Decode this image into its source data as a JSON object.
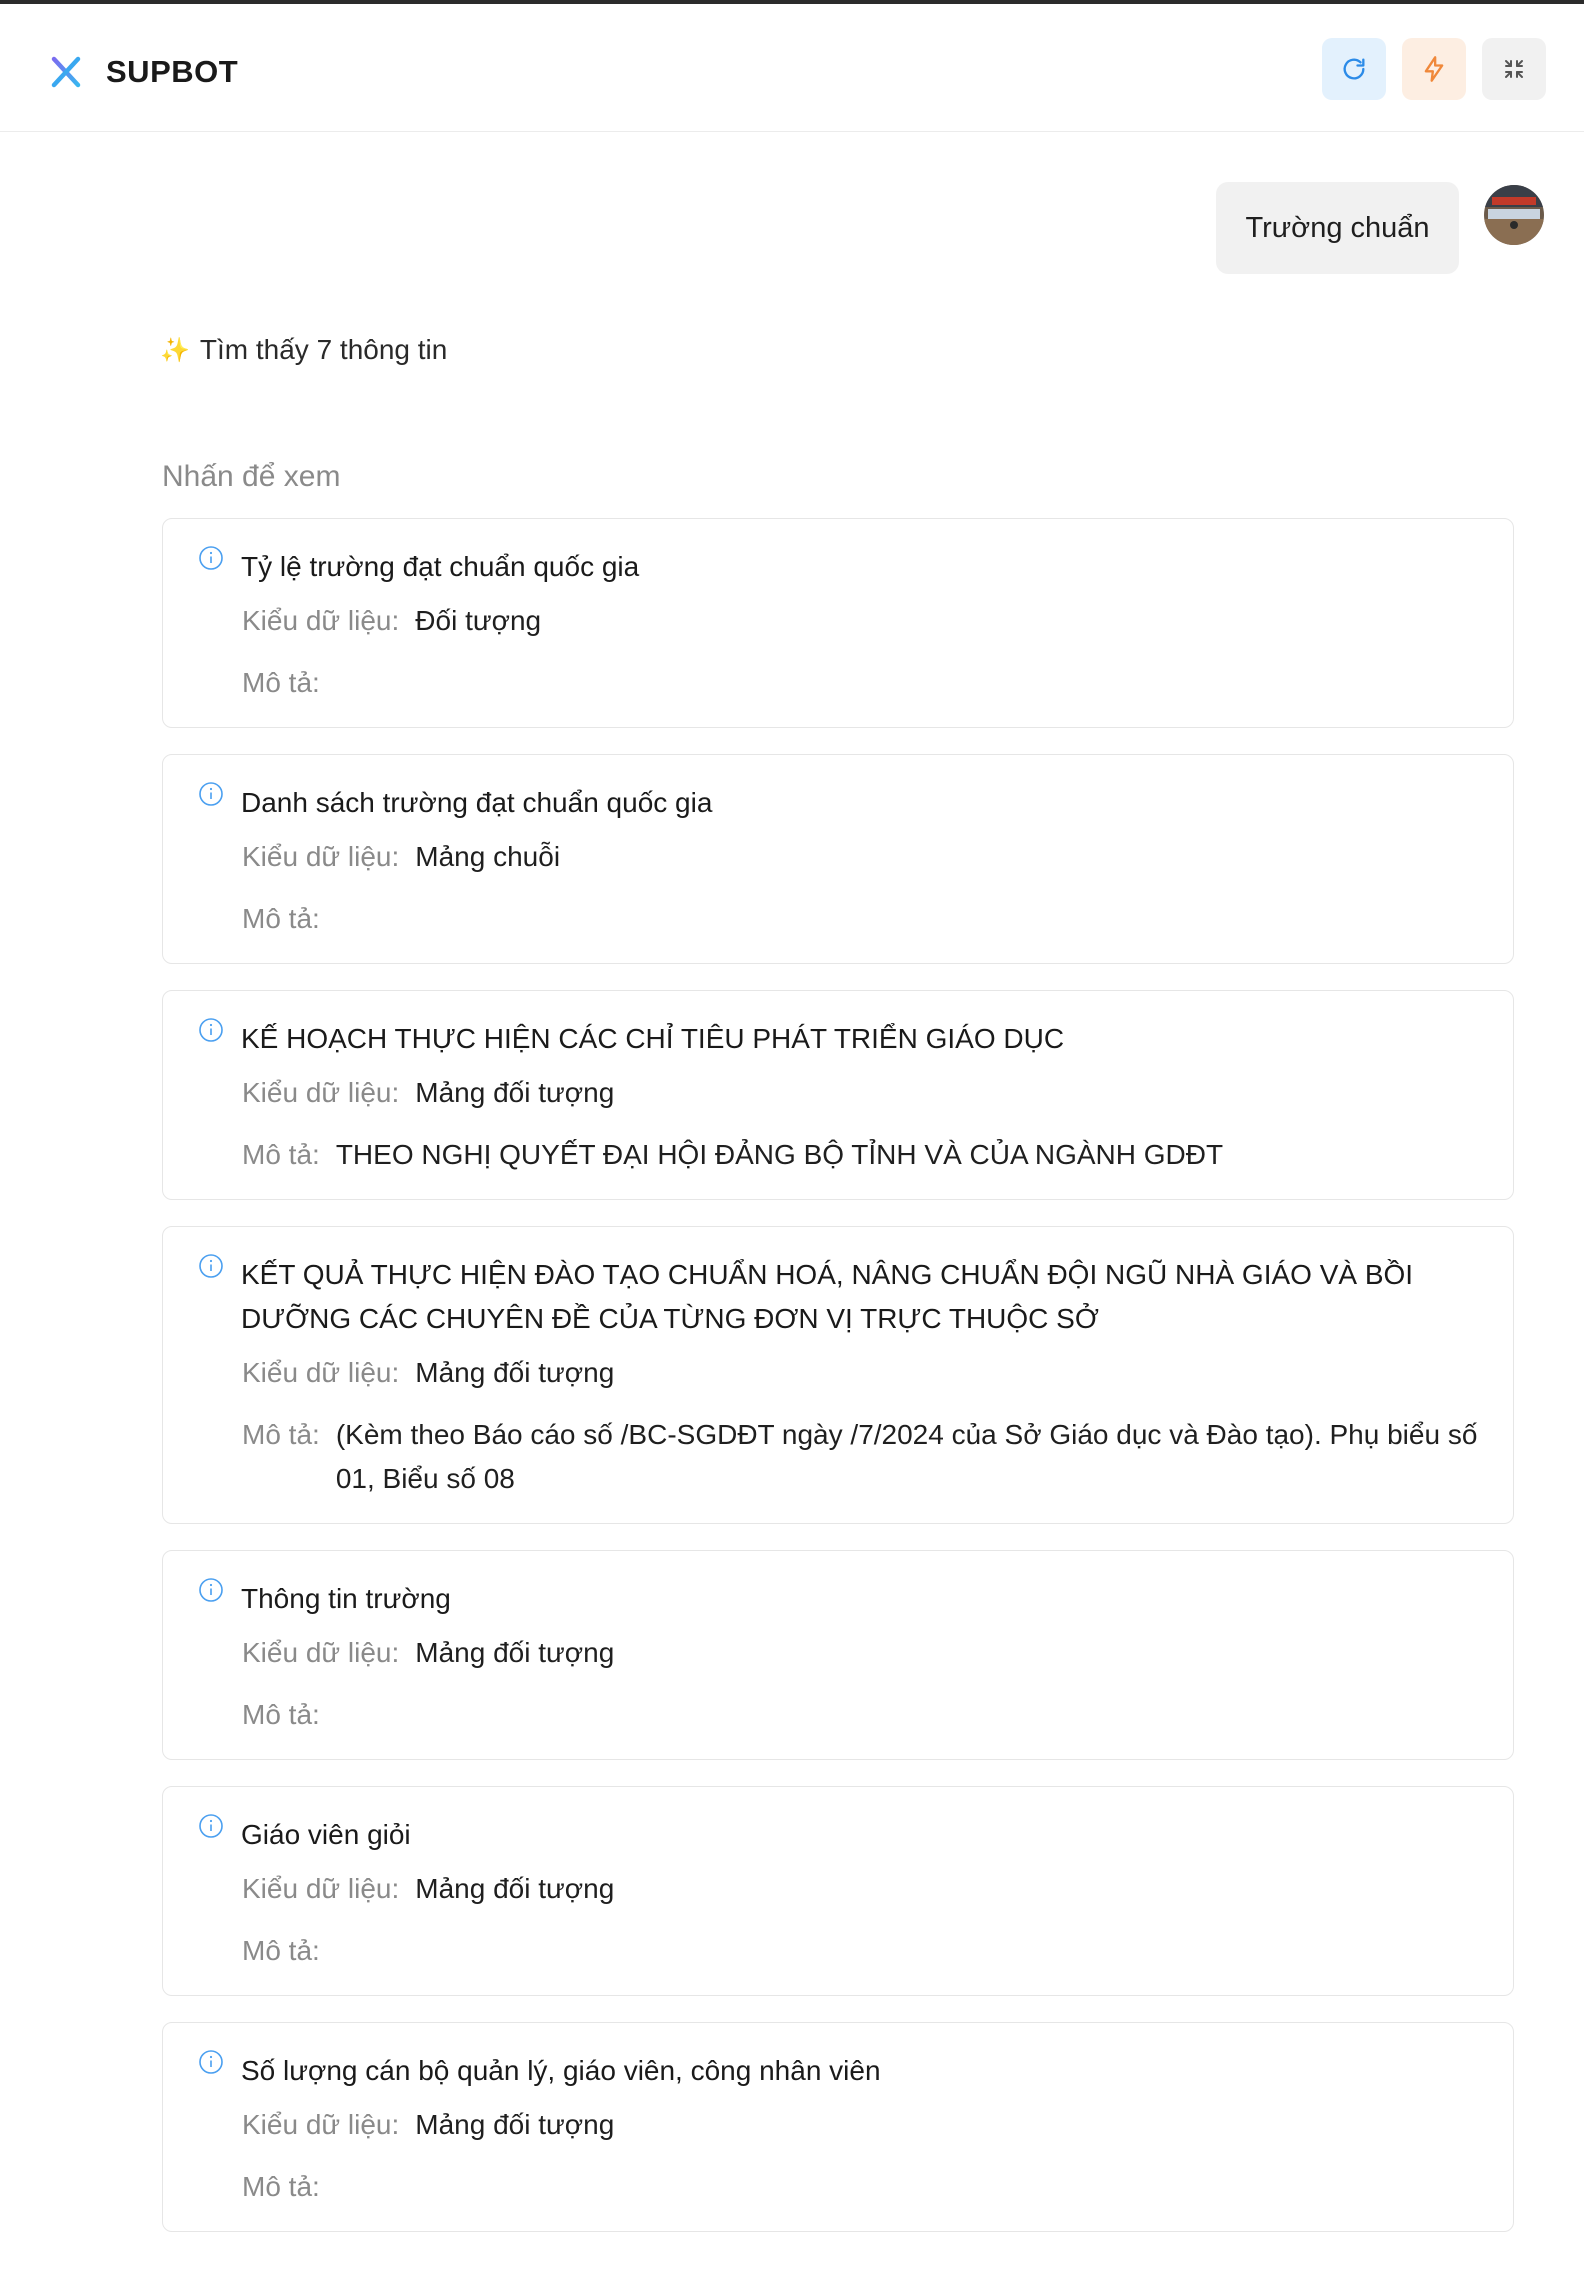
{
  "header": {
    "app_title": "SUPBOT",
    "logo_icon": "x-logo-icon",
    "buttons": {
      "refresh_icon": "refresh-icon",
      "flash_icon": "lightning-icon",
      "collapse_icon": "collapse-icon"
    },
    "colors": {
      "refresh_bg": "#e3f1fd",
      "refresh_fg": "#2b8be8",
      "flash_bg": "#fdeee2",
      "flash_fg": "#f0883a"
    }
  },
  "chat": {
    "user_message": "Trường chuẩn",
    "found_text": "Tìm thấy 7 thông tin",
    "found_icon": "sparkles-icon",
    "hint": "Nhấn để xem"
  },
  "labels": {
    "type_label": "Kiểu dữ liệu:",
    "desc_label": "Mô tả:"
  },
  "results": [
    {
      "title": "Tỷ lệ trường đạt chuẩn quốc gia",
      "type": "Đối tượng",
      "description": ""
    },
    {
      "title": "Danh sách trường đạt chuẩn quốc gia",
      "type": "Mảng chuỗi",
      "description": ""
    },
    {
      "title": "KẾ HOẠCH THỰC HIỆN CÁC CHỈ TIÊU PHÁT TRIỂN GIÁO DỤC",
      "type": "Mảng đối tượng",
      "description": "THEO NGHỊ QUYẾT ĐẠI HỘI ĐẢNG BỘ TỈNH VÀ CỦA NGÀNH GDĐT"
    },
    {
      "title": "KẾT QUẢ THỰC HIỆN ĐÀO TẠO CHUẨN HOÁ, NÂNG CHUẨN ĐỘI NGŨ NHÀ GIÁO VÀ BỒI DƯỠNG CÁC CHUYÊN ĐỀ CỦA TỪNG ĐƠN VỊ TRỰC THUỘC SỞ",
      "type": "Mảng đối tượng",
      "description": "(Kèm theo Báo cáo số /BC-SGDĐT ngày /7/2024 của Sở Giáo dục và Đào tạo). Phụ biểu số 01, Biểu số 08"
    },
    {
      "title": "Thông tin trường",
      "type": "Mảng đối tượng",
      "description": ""
    },
    {
      "title": "Giáo viên giỏi",
      "type": "Mảng đối tượng",
      "description": ""
    },
    {
      "title": "Số lượng cán bộ quản lý, giáo viên, công nhân viên",
      "type": "Mảng đối tượng",
      "description": ""
    }
  ],
  "result_icon": "info-circle-icon"
}
